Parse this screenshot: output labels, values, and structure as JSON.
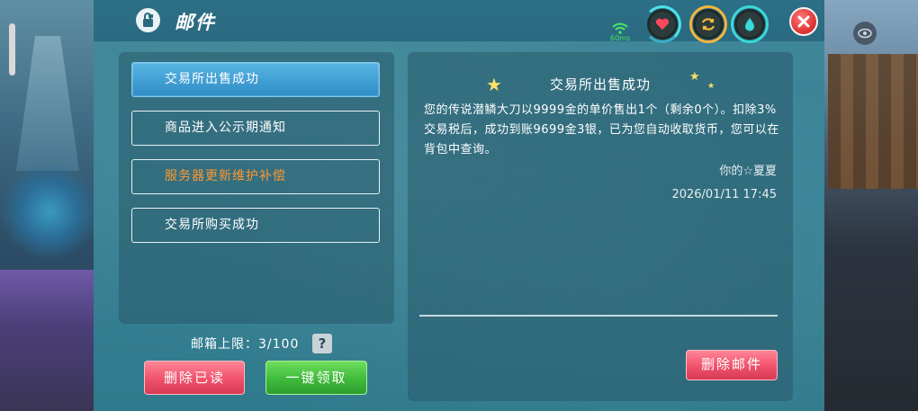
{
  "window": {
    "title": "邮件",
    "ping": "60ms"
  },
  "colors": {
    "accent_blue": "#2f8cc7",
    "unread_orange": "#ff9830",
    "delete_red": "#f0516b",
    "claim_green": "#3fba3b"
  },
  "icons": {
    "mail": "mail-icon",
    "close": "close-icon",
    "heart": "heart-icon",
    "swap": "swap-icon",
    "water": "water-drop-icon",
    "wifi": "wifi-icon",
    "eye": "eye-icon",
    "help": "help-icon"
  },
  "mail_list": [
    {
      "label": "交易所出售成功",
      "state": "selected"
    },
    {
      "label": "商品进入公示期通知",
      "state": "read"
    },
    {
      "label": "服务器更新维护补偿",
      "state": "unread"
    },
    {
      "label": "交易所购买成功",
      "state": "read"
    }
  ],
  "mailbox": {
    "limit_label": "邮箱上限：3/100",
    "help_label": "?",
    "delete_read_label": "删除已读",
    "claim_all_label": "一键领取"
  },
  "detail": {
    "title": "交易所出售成功",
    "body": "您的传说潜鳞大刀以9999金的单价售出1个（剩余0个）。扣除3%交易税后，成功到账9699金3银，已为您自动收取货币，您可以在背包中查询。",
    "sender": "你的☆夏夏",
    "date": "2026/01/11 17:45",
    "delete_label": "删除邮件"
  }
}
